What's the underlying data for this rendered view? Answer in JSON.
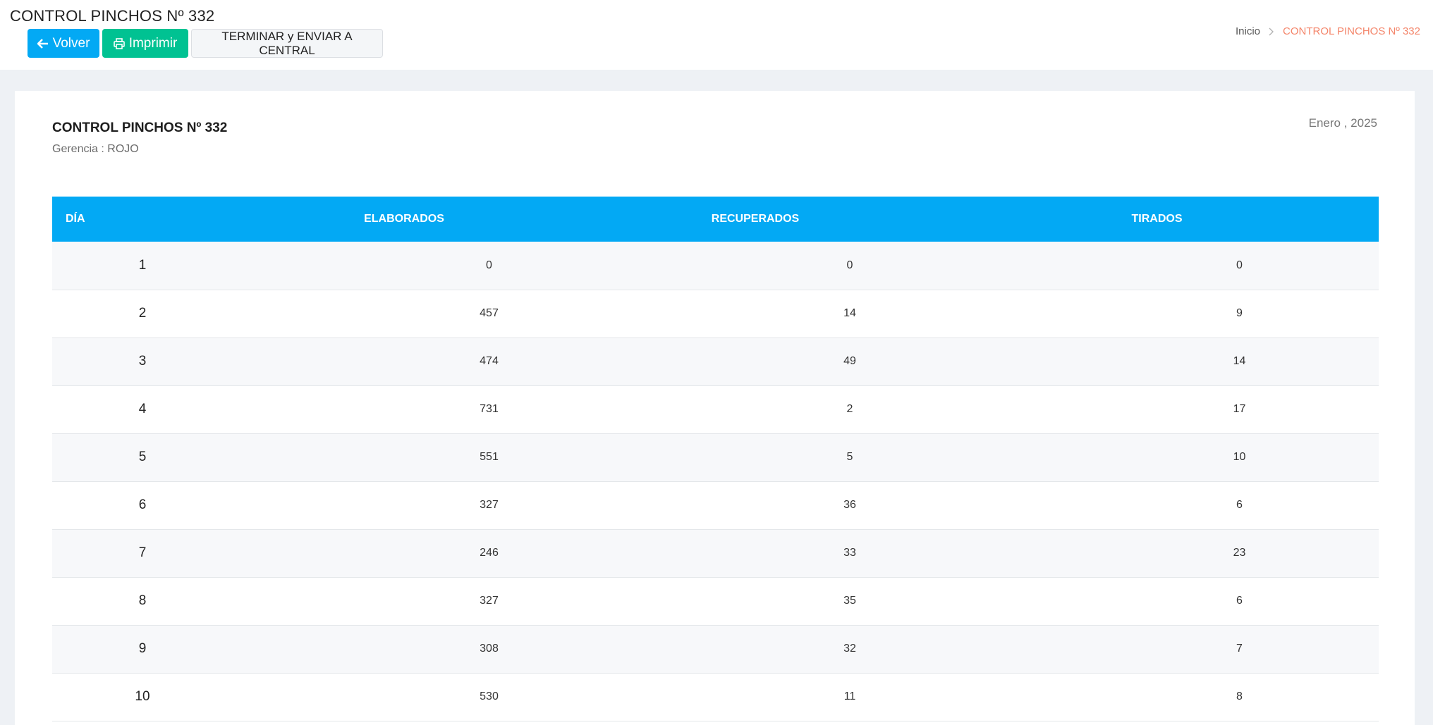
{
  "header": {
    "title": "CONTROL PINCHOS Nº 332",
    "buttons": {
      "back_label": "Volver",
      "print_label": "Imprimir",
      "finish_label": "TERMINAR y ENVIAR A CENTRAL"
    },
    "breadcrumb": {
      "home": "Inicio",
      "current": "CONTROL PINCHOS Nº 332"
    }
  },
  "report": {
    "title": "CONTROL PINCHOS Nº 332",
    "subtitle": "Gerencia : ROJO",
    "date": "Enero , 2025"
  },
  "table": {
    "headers": {
      "day": "DÍA",
      "elaborados": "ELABORADOS",
      "recuperados": "RECUPERADOS",
      "tirados": "TIRADOS"
    },
    "rows": [
      {
        "day": "1",
        "elaborados": "0",
        "recuperados": "0",
        "tirados": "0"
      },
      {
        "day": "2",
        "elaborados": "457",
        "recuperados": "14",
        "tirados": "9"
      },
      {
        "day": "3",
        "elaborados": "474",
        "recuperados": "49",
        "tirados": "14"
      },
      {
        "day": "4",
        "elaborados": "731",
        "recuperados": "2",
        "tirados": "17"
      },
      {
        "day": "5",
        "elaborados": "551",
        "recuperados": "5",
        "tirados": "10"
      },
      {
        "day": "6",
        "elaborados": "327",
        "recuperados": "36",
        "tirados": "6"
      },
      {
        "day": "7",
        "elaborados": "246",
        "recuperados": "33",
        "tirados": "23"
      },
      {
        "day": "8",
        "elaborados": "327",
        "recuperados": "35",
        "tirados": "6"
      },
      {
        "day": "9",
        "elaborados": "308",
        "recuperados": "32",
        "tirados": "7"
      },
      {
        "day": "10",
        "elaborados": "530",
        "recuperados": "11",
        "tirados": "8"
      }
    ]
  },
  "icons": {
    "back": "arrow-left-icon",
    "print": "printer-icon",
    "separator": "chevron-right-icon"
  },
  "colors": {
    "primary": "#03a9f4",
    "success": "#00c292",
    "breadcrumb_active": "#f4856a"
  }
}
